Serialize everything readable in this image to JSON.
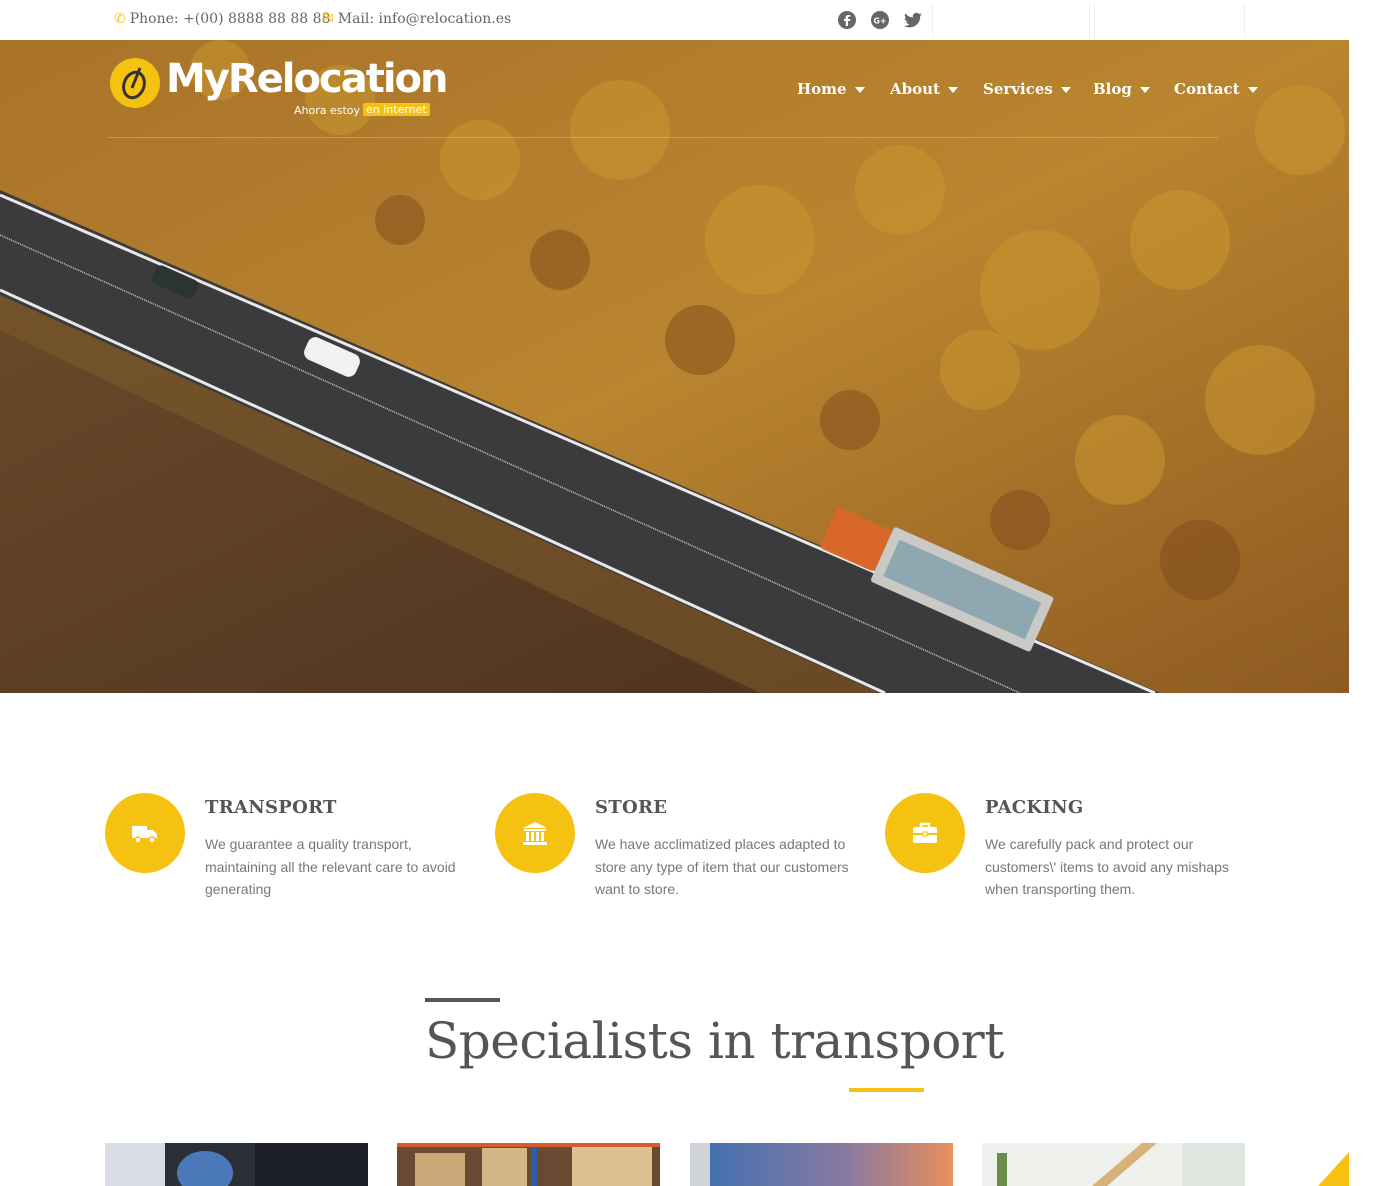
{
  "topbar": {
    "phone": "Phone: +(00) 8888 88 88 88",
    "mail": "Mail: info@relocation.es",
    "social": [
      "facebook-icon",
      "google-plus-icon",
      "twitter-icon"
    ]
  },
  "brand": {
    "name": "MyRelocation",
    "sub": "Ahora estoy",
    "tag": "en internet"
  },
  "nav": {
    "items": [
      {
        "label": "Home"
      },
      {
        "label": "About"
      },
      {
        "label": "Services"
      },
      {
        "label": "Blog"
      },
      {
        "label": "Contact"
      }
    ]
  },
  "features": [
    {
      "title": "TRANSPORT",
      "icon": "truck-icon",
      "text": "We guarantee a quality transport, maintaining all the relevant care to avoid generating"
    },
    {
      "title": "STORE",
      "icon": "warehouse-icon",
      "text": "We have acclimatized places adapted to store any type of item that our customers want to store."
    },
    {
      "title": "PACKING",
      "icon": "briefcase-icon",
      "text": "We carefully pack and protect our customers\\' items to avoid any mishaps when transporting them."
    }
  ],
  "section": {
    "title": "Specialists in transport"
  },
  "colors": {
    "accent": "#f5c211",
    "text": "#555555"
  }
}
